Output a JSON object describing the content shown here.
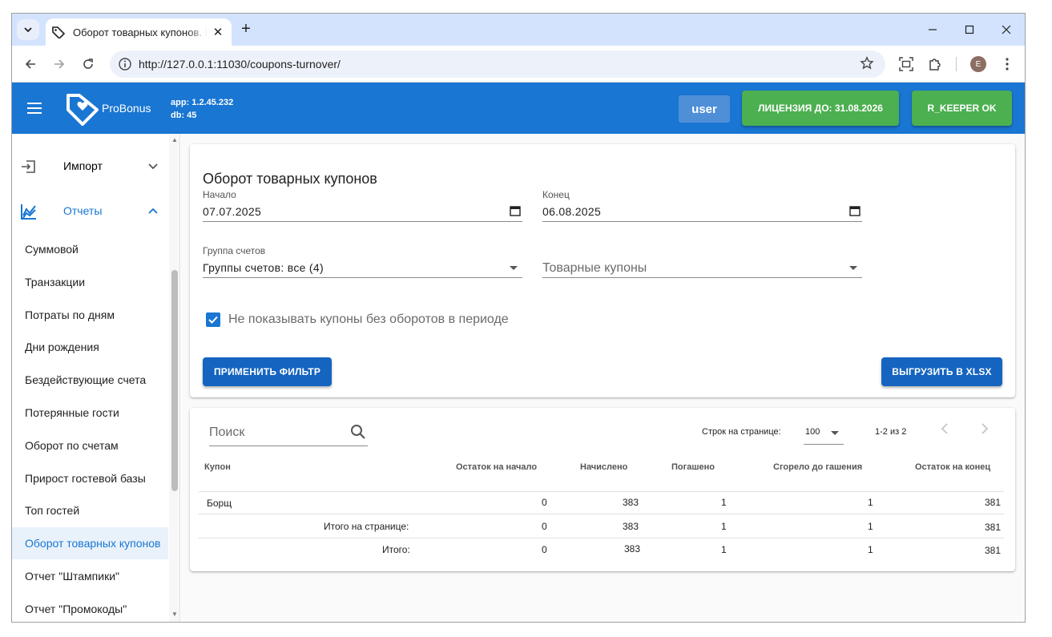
{
  "browser": {
    "tab_title": "Оборот товарных купонов. ProBonus",
    "url": "http://127.0.0.1:11030/coupons-turnover/",
    "profile_initial": "E",
    "new_tab_label": "+"
  },
  "appbar": {
    "brand": "ProBonus",
    "app_version": "app: 1.2.45.232",
    "db_version": "db: 45",
    "user_label": "user",
    "license_label": "ЛИЦЕНЗИЯ ДО: 31.08.2026",
    "rkeeper_label": "R_KEEPER OK",
    "accent": "#1976d2",
    "ok_color": "#4caf50"
  },
  "sidebar": {
    "groups": [
      {
        "label": "Импорт",
        "icon": "import-icon"
      },
      {
        "label": "Отчеты",
        "icon": "chart-line-icon"
      }
    ],
    "items": [
      {
        "label": "Суммовой"
      },
      {
        "label": "Транзакции"
      },
      {
        "label": "Потраты по дням"
      },
      {
        "label": "Дни рождения"
      },
      {
        "label": "Бездействующие счета"
      },
      {
        "label": "Потерянные гости"
      },
      {
        "label": "Оборот по счетам"
      },
      {
        "label": "Прирост гостевой базы"
      },
      {
        "label": "Топ гостей"
      },
      {
        "label": "Оборот товарных купонов"
      },
      {
        "label": "Отчет \"Штампики\""
      },
      {
        "label": "Отчет \"Промокоды\""
      }
    ],
    "active_index": 9
  },
  "filter": {
    "title": "Оборот товарных купонов",
    "start_label": "Начало",
    "start_value": "07.07.2025",
    "end_label": "Конец",
    "end_value": "06.08.2025",
    "group_label": "Группа счетов",
    "group_value": "Группы счетов: все (4)",
    "coupons_placeholder": "Товарные купоны",
    "hide_empty_label": "Не показывать купоны без оборотов в периоде",
    "hide_empty_checked": true,
    "apply_label": "ПРИМЕНИТЬ ФИЛЬТР",
    "export_label": "ВЫГРУЗИТЬ В XLSX"
  },
  "table": {
    "search_placeholder": "Поиск",
    "rows_per_page_label": "Строк на странице:",
    "rows_per_page_value": "100",
    "range_label": "1-2 из 2",
    "headers": [
      "Купон",
      "Остаток на начало",
      "Начислено",
      "Погашено",
      "Сгорело до гашения",
      "Остаток на конец"
    ],
    "rows": [
      {
        "coupon": "Борщ",
        "start": "0",
        "accrued": "383",
        "redeemed": "1",
        "burned": "1",
        "end": "381"
      }
    ],
    "page_total": {
      "label": "Итого на странице:",
      "start": "0",
      "accrued": "383",
      "redeemed": "1",
      "burned": "1",
      "end": "381"
    },
    "grand_total": {
      "label": "Итого:",
      "start": "0",
      "accrued": "383",
      "redeemed": "1",
      "burned": "1",
      "end": "381"
    }
  }
}
